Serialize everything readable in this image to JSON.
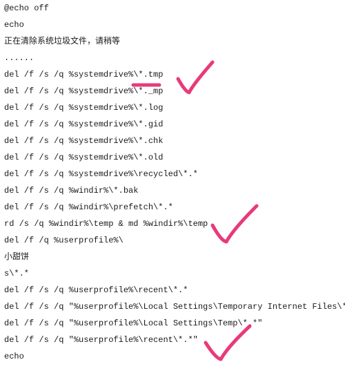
{
  "lines": [
    "@echo off",
    "echo",
    "正在清除系统垃圾文件，请稍等",
    "......",
    "del /f /s /q %systemdrive%\\*.tmp",
    "del /f /s /q %systemdrive%\\*._mp",
    "del /f /s /q %systemdrive%\\*.log",
    "del /f /s /q %systemdrive%\\*.gid",
    "del /f /s /q %systemdrive%\\*.chk",
    "del /f /s /q %systemdrive%\\*.old",
    "del /f /s /q %systemdrive%\\recycled\\*.*",
    "del /f /s /q %windir%\\*.bak",
    "del /f /s /q %windir%\\prefetch\\*.*",
    "rd /s /q %windir%\\temp & md %windir%\\temp",
    "del /f /q %userprofile%\\",
    "小甜饼",
    "s\\*.*",
    "del /f /s /q %userprofile%\\recent\\*.*",
    "del /f /s /q \"%userprofile%\\Local Settings\\Temporary Internet Files\\*.*\"",
    "del /f /s /q \"%userprofile%\\Local Settings\\Temp\\*.*\"",
    "del /f /s /q \"%userprofile%\\recent\\*.*\"",
    "echo"
  ],
  "annotations": {
    "underline1": {
      "near_line": 4,
      "text_ref": "*.tmp"
    },
    "check1": {
      "near_line_range": [
        4,
        5
      ]
    },
    "check2": {
      "near_line_range": [
        12,
        14
      ]
    },
    "check3": {
      "near_line_range": [
        19,
        21
      ]
    }
  }
}
